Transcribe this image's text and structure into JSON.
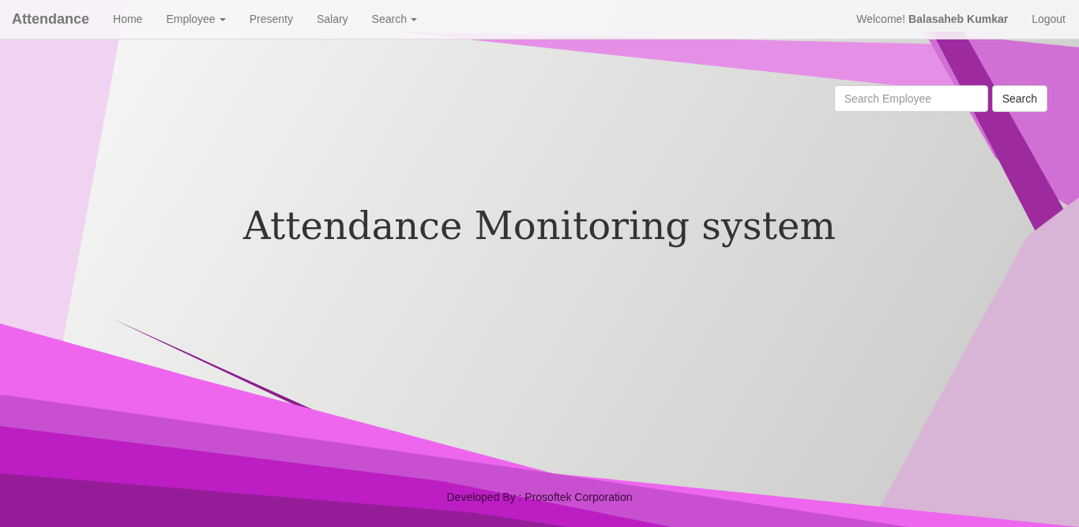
{
  "navbar": {
    "brand": "Attendance",
    "items": [
      {
        "label": "Home",
        "dropdown": false
      },
      {
        "label": "Employee",
        "dropdown": true
      },
      {
        "label": "Presenty",
        "dropdown": false
      },
      {
        "label": "Salary",
        "dropdown": false
      },
      {
        "label": "Search",
        "dropdown": true
      }
    ],
    "welcome": "Welcome! **Balasaheb Kumkar**",
    "logout": "Logout"
  },
  "search": {
    "placeholder": "Search Employee",
    "button": "Search"
  },
  "heading": "Attendance Monitoring system",
  "footer": "Developed By : Prosoftek Corporation"
}
